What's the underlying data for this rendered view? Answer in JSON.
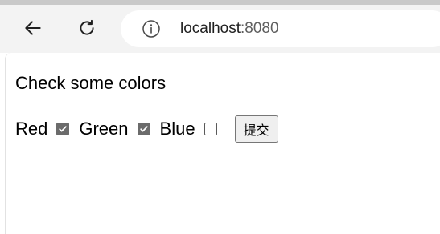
{
  "browser": {
    "back_icon": "arrow-left-icon",
    "reload_icon": "refresh-icon",
    "info_icon": "info-icon",
    "url_host": "localhost",
    "url_port": ":8080"
  },
  "page": {
    "heading": "Check some colors",
    "colors": [
      {
        "label": "Red",
        "checked": true
      },
      {
        "label": "Green",
        "checked": true
      },
      {
        "label": "Blue",
        "checked": false
      }
    ],
    "submit_label": "提交"
  }
}
